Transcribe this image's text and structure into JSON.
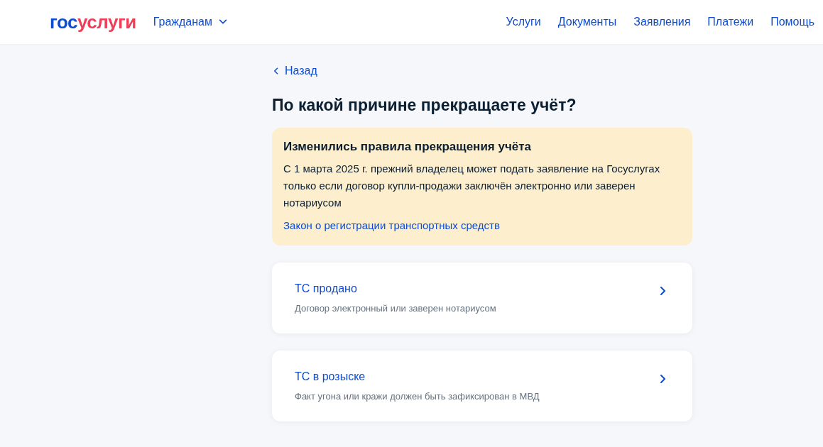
{
  "header": {
    "logo": {
      "first": "гос",
      "second": "услуги"
    },
    "audience": {
      "label": "Гражданам",
      "expanded": false
    },
    "nav": [
      "Услуги",
      "Документы",
      "Заявления",
      "Платежи",
      "Помощь"
    ]
  },
  "back": "Назад",
  "title": "По какой причине прекращаете учёт?",
  "notice": {
    "title": "Изменились правила прекращения учёта",
    "text": "С 1 марта 2025 г. прежний владелец может подать заявление на Госуслугах только если договор купли-продажи заключён электронно или заверен нотариусом",
    "link": "Закон о регистрации транспортных средств"
  },
  "options": [
    {
      "title": "ТС продано",
      "subtitle": "Договор электронный или заверен нотариусом"
    },
    {
      "title": "ТС в розыске",
      "subtitle": "Факт угона или кражи должен быть зафиксирован в МВД"
    }
  ]
}
